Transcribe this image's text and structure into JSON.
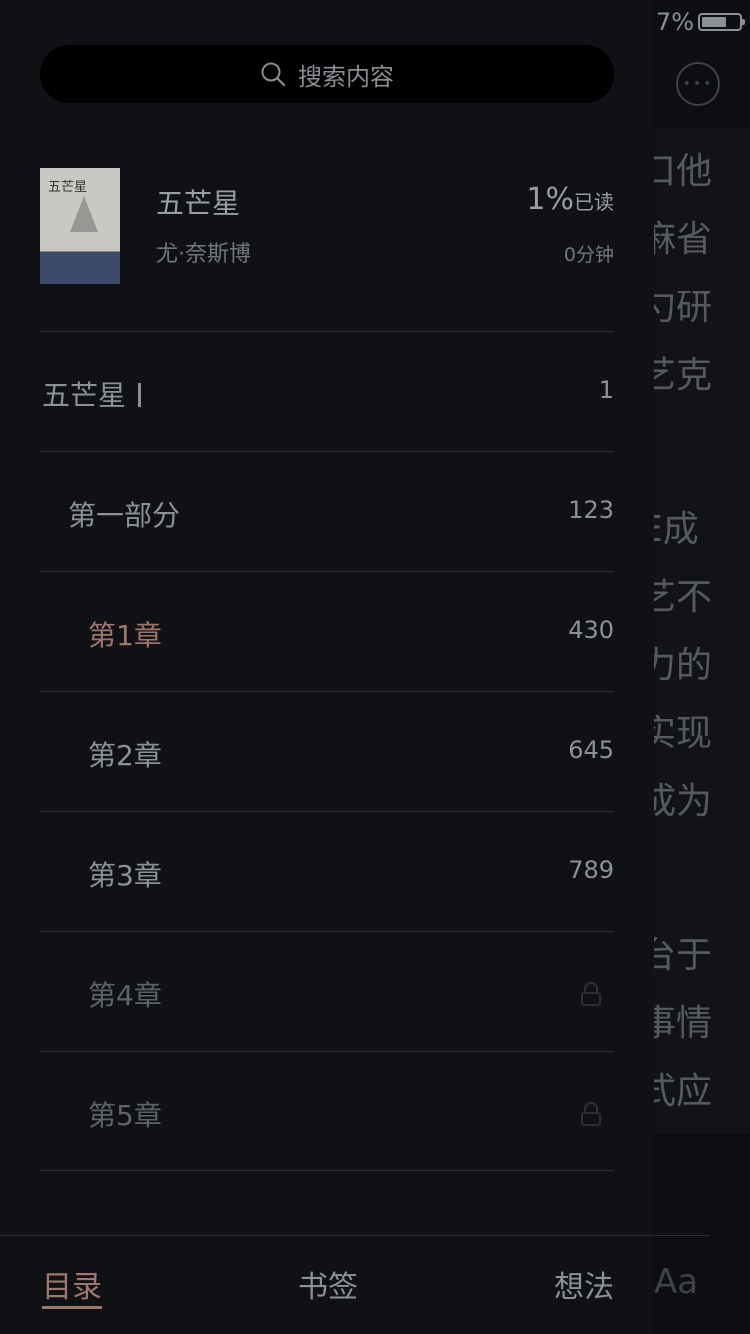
{
  "status_bar": {
    "battery_text": "7%"
  },
  "reader": {
    "lines": [
      "口他",
      "麻省",
      "勺研",
      "艺克",
      "",
      "E成",
      "艺不",
      "力的",
      "实现",
      "成为",
      "",
      "台于",
      "事情",
      "式应"
    ],
    "font_size_label": "Aa"
  },
  "drawer": {
    "search_placeholder": "搜索内容",
    "book": {
      "cover_title": "五芒星",
      "title": "五芒星",
      "author": "尤·奈斯博",
      "progress_value": "1%",
      "progress_label": "已读",
      "read_time": "0分钟"
    },
    "toc": [
      {
        "label": "五芒星",
        "page": "1",
        "level": 0,
        "state": "normal",
        "cursor": true
      },
      {
        "label": "第一部分",
        "page": "123",
        "level": 1,
        "state": "normal"
      },
      {
        "label": "第1章",
        "page": "430",
        "level": 2,
        "state": "current"
      },
      {
        "label": "第2章",
        "page": "645",
        "level": 2,
        "state": "normal"
      },
      {
        "label": "第3章",
        "page": "789",
        "level": 2,
        "state": "normal"
      },
      {
        "label": "第4章",
        "page": "",
        "level": 2,
        "state": "locked"
      },
      {
        "label": "第5章",
        "page": "",
        "level": 2,
        "state": "locked"
      }
    ],
    "tabs": [
      {
        "label": "目录",
        "active": true
      },
      {
        "label": "书签",
        "active": false
      },
      {
        "label": "想法",
        "active": false
      }
    ]
  },
  "colors": {
    "accent": "#a0766c",
    "background": "#0f1115",
    "text": "#8d9197"
  }
}
